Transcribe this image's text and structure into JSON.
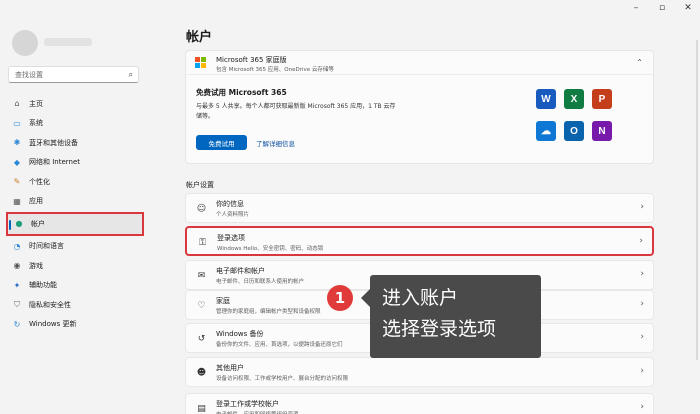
{
  "window": {
    "minimize": "–",
    "maximize": "▫",
    "close": "✕"
  },
  "sidebar": {
    "search_placeholder": "查找设置",
    "items": [
      {
        "label": "主页",
        "icon": "home-icon",
        "glyph": "⌂",
        "color": "#555555"
      },
      {
        "label": "系统",
        "icon": "system-icon",
        "glyph": "▭",
        "color": "#2b88d8"
      },
      {
        "label": "蓝牙和其他设备",
        "icon": "bluetooth-icon",
        "glyph": "✱",
        "color": "#2b88d8"
      },
      {
        "label": "网络和 Internet",
        "icon": "network-icon",
        "glyph": "◆",
        "color": "#2b88d8"
      },
      {
        "label": "个性化",
        "icon": "personalization-icon",
        "glyph": "✎",
        "color": "#c97a25"
      },
      {
        "label": "应用",
        "icon": "apps-icon",
        "glyph": "▦",
        "color": "#555555"
      },
      {
        "label": "帐户",
        "icon": "account-icon",
        "glyph": "●",
        "color": "#1e9e7a",
        "active": true
      },
      {
        "label": "时间和语言",
        "icon": "time-language-icon",
        "glyph": "◔",
        "color": "#2b88d8"
      },
      {
        "label": "游戏",
        "icon": "gaming-icon",
        "glyph": "◉",
        "color": "#555555"
      },
      {
        "label": "辅助功能",
        "icon": "accessibility-icon",
        "glyph": "✦",
        "color": "#2b6cc4"
      },
      {
        "label": "隐私和安全性",
        "icon": "privacy-icon",
        "glyph": "⛉",
        "color": "#666666"
      },
      {
        "label": "Windows 更新",
        "icon": "windows-update-icon",
        "glyph": "↻",
        "color": "#2b88d8"
      }
    ]
  },
  "main": {
    "title": "帐户",
    "ms365": {
      "title": "Microsoft 365 家庭版",
      "subtitle": "包含 Microsoft 365 应用、OneDrive 云存储等",
      "trial_title": "免费试用 Microsoft 365",
      "trial_desc": "与最多 5 人共享。每个人都可获取最新版 Microsoft 365 应用，1 TB 云存储等。",
      "primary_button": "免费试用",
      "link": "了解详细信息",
      "apps": [
        {
          "name": "word-icon",
          "letter": "W",
          "color": "#185abd"
        },
        {
          "name": "excel-icon",
          "letter": "X",
          "color": "#107c41"
        },
        {
          "name": "powerpoint-icon",
          "letter": "P",
          "color": "#c43e1c"
        },
        {
          "name": "onedrive-icon",
          "letter": "☁",
          "color": "#0f78d4"
        },
        {
          "name": "outlook-icon",
          "letter": "O",
          "color": "#0a64ad"
        },
        {
          "name": "onenote-icon",
          "letter": "N",
          "color": "#7719aa"
        }
      ]
    },
    "section_label": "帐户设置",
    "rows": [
      {
        "name": "your-info",
        "title": "你的信息",
        "sub": "个人资料照片",
        "icon": "person-icon",
        "glyph": "☺"
      },
      {
        "name": "sign-in-options",
        "title": "登录选项",
        "sub": "Windows Hello、安全密钥、密码、动态锁",
        "icon": "key-icon",
        "glyph": "⚿",
        "highlight": true
      },
      {
        "name": "email-accounts",
        "title": "电子邮件和帐户",
        "sub": "电子邮件、日历和联系人使用的帐户",
        "icon": "mail-icon",
        "glyph": "✉"
      },
      {
        "name": "family",
        "title": "家庭",
        "sub": "管理你的家庭组，编辑帐户类型和设备权限",
        "icon": "family-icon",
        "glyph": "♡"
      },
      {
        "name": "windows-backup",
        "title": "Windows 备份",
        "sub": "备份你的文件、应用、首选项，以便跨设备还原它们",
        "icon": "backup-icon",
        "glyph": "↺"
      },
      {
        "name": "other-users",
        "title": "其他用户",
        "sub": "设备访问权限、工作或学校用户、展台分配的访问权限",
        "icon": "users-icon",
        "glyph": "☻"
      },
      {
        "name": "work-school",
        "title": "登录工作或学校帐户",
        "sub": "电子邮件、应用和网络等组织资源",
        "icon": "briefcase-icon",
        "glyph": "▤"
      }
    ]
  },
  "annotation": {
    "step": "1",
    "line1": "进入账户",
    "line2": "选择登录选项"
  },
  "chevron": "›"
}
